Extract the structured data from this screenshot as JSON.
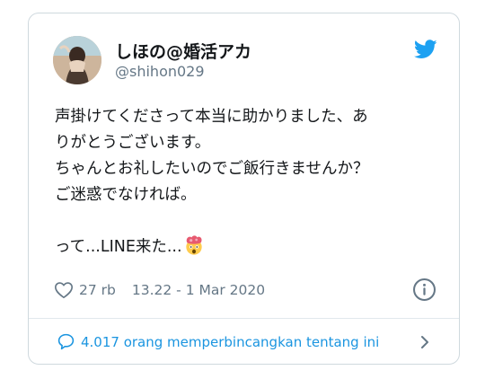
{
  "user": {
    "name": "しほの@婚活アカ",
    "handle": "@shihon029"
  },
  "tweet": {
    "text": "声掛けてくださって本当に助かりました、あ\nりがとうございます。\nちゃんとお礼したいのでご飯行きませんか？\nご迷惑でなければ。\n\nって...LINE来た...",
    "emoji": "exploding-head-emoji"
  },
  "meta": {
    "likes": "27 rb",
    "timestamp": "13.22 - 1 Mar 2020"
  },
  "footer": {
    "conversation": "4.017 orang memperbincangkan tentang ini"
  },
  "colors": {
    "accent": "#1da1f2",
    "link": "#1b95e0",
    "secondary_text": "#657786",
    "border": "#cfd9de"
  },
  "icons": [
    "twitter-bird-icon",
    "heart-icon",
    "info-icon",
    "speech-bubble-icon",
    "chevron-right-icon"
  ]
}
